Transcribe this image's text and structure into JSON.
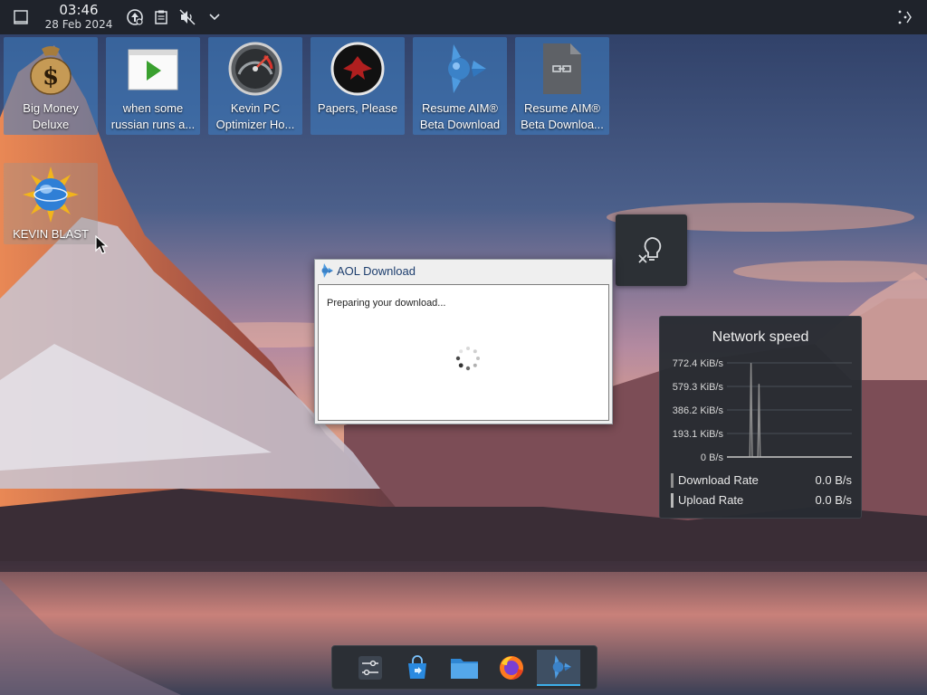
{
  "clock": {
    "time": "03:46",
    "date": "28 Feb 2024"
  },
  "top_panel": {
    "icons": [
      "show-desktop-icon",
      "update-icon",
      "clipboard-icon",
      "volume-muted-icon",
      "chevron-down-icon",
      "panel-menu-icon"
    ]
  },
  "desktop_icons": [
    {
      "label": "Big Money\nDeluxe",
      "icon": "money-bag-icon"
    },
    {
      "label": "when some\nrussian runs a...",
      "icon": "video-play-icon"
    },
    {
      "label": "Kevin PC\nOptimizer Ho...",
      "icon": "speedometer-icon"
    },
    {
      "label": "Papers, Please",
      "icon": "red-eagle-emblem-icon"
    },
    {
      "label": "Resume AIM®\nBeta Download",
      "icon": "aol-runner-icon"
    },
    {
      "label": "Resume AIM®\nBeta Downloa...",
      "icon": "file-shortcut-icon"
    },
    {
      "label": "KEVIN BLAST",
      "icon": "sun-globe-icon"
    }
  ],
  "aol_dialog": {
    "title": "AOL Download",
    "status": "Preparing your download..."
  },
  "notification": {
    "icon": "lightbulb-disabled-icon"
  },
  "network_widget": {
    "title": "Network speed",
    "rates": [
      {
        "name": "Download Rate",
        "value": "0.0 B/s",
        "color": "#8f8f8f"
      },
      {
        "name": "Upload Rate",
        "value": "0.0 B/s",
        "color": "#b9b9b9"
      }
    ]
  },
  "chart_data": {
    "type": "line",
    "title": "Network speed",
    "yticks": [
      "772.4 KiB/s",
      "579.3 KiB/s",
      "386.2 KiB/s",
      "193.1 KiB/s",
      "0 B/s"
    ],
    "ylim": [
      0,
      772.4
    ],
    "series": [
      {
        "name": "Download Rate",
        "color": "#8f8f8f",
        "values": [
          0,
          0,
          0,
          0,
          0,
          0,
          0,
          0,
          0,
          0,
          0,
          0,
          0,
          0,
          0,
          0,
          0,
          0,
          0,
          0,
          0,
          772,
          0,
          0,
          0,
          0,
          0,
          0,
          600,
          0,
          0,
          0,
          0,
          0,
          0,
          0,
          0,
          0,
          0,
          0,
          0,
          0,
          0,
          0,
          0,
          0,
          0,
          0,
          0,
          0,
          0,
          0,
          0,
          0,
          0,
          0,
          0,
          0,
          0,
          0,
          0,
          0,
          0,
          0,
          0,
          0,
          0,
          0,
          0,
          0,
          0,
          0,
          0,
          0,
          0,
          0,
          0,
          0,
          0,
          0,
          0,
          0,
          0,
          0,
          0,
          0,
          0,
          0,
          0,
          0,
          0,
          0,
          0,
          0,
          0,
          0,
          0,
          0,
          0,
          0,
          0,
          0,
          0,
          0,
          0,
          0,
          0,
          0,
          0,
          0
        ]
      },
      {
        "name": "Upload Rate",
        "color": "#b9b9b9",
        "values": [
          0,
          0,
          0,
          0,
          0,
          0,
          0,
          0,
          0,
          0,
          0,
          0,
          0,
          0,
          0,
          0,
          0,
          0,
          0,
          0,
          0,
          0,
          0,
          0,
          0,
          0,
          0,
          0,
          0,
          0,
          0,
          0,
          0,
          0,
          0,
          0,
          0,
          0,
          0,
          0,
          0,
          0,
          0,
          0,
          0,
          0,
          0,
          0,
          0,
          0,
          0,
          0,
          0,
          0,
          0,
          0,
          0,
          0,
          0,
          0,
          0,
          0,
          0,
          0,
          0,
          0,
          0,
          0,
          0,
          0,
          0,
          0,
          0,
          0,
          0,
          0,
          0,
          0,
          0,
          0,
          0,
          0,
          0,
          0,
          0,
          0,
          0,
          0,
          0,
          0,
          0,
          0,
          0,
          0,
          0,
          0,
          0,
          0,
          0,
          0,
          0,
          0,
          0,
          0,
          0,
          0,
          0,
          0,
          0,
          0,
          0
        ]
      }
    ]
  },
  "dock": {
    "items": [
      {
        "icon": "system-settings-icon",
        "active": false
      },
      {
        "icon": "discover-store-icon",
        "active": false
      },
      {
        "icon": "file-manager-icon",
        "active": false
      },
      {
        "icon": "firefox-icon",
        "active": false
      },
      {
        "icon": "aol-runner-icon",
        "active": true
      }
    ]
  }
}
